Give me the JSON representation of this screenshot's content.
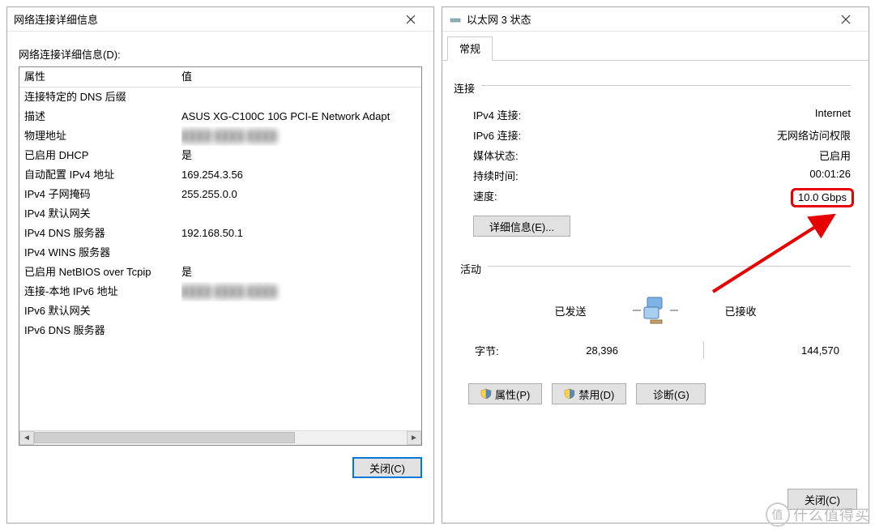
{
  "left": {
    "title": "网络连接详细信息",
    "subtitle": "网络连接详细信息(D):",
    "header_prop": "属性",
    "header_val": "值",
    "rows": [
      {
        "prop": "连接特定的 DNS 后缀",
        "val": ""
      },
      {
        "prop": "描述",
        "val": "ASUS XG-C100C 10G PCI-E Network Adapt"
      },
      {
        "prop": "物理地址",
        "val": "",
        "blurred": true
      },
      {
        "prop": "已启用 DHCP",
        "val": "是"
      },
      {
        "prop": "自动配置 IPv4 地址",
        "val": "169.254.3.56"
      },
      {
        "prop": "IPv4 子网掩码",
        "val": "255.255.0.0"
      },
      {
        "prop": "IPv4 默认网关",
        "val": ""
      },
      {
        "prop": "IPv4 DNS 服务器",
        "val": "192.168.50.1"
      },
      {
        "prop": "IPv4 WINS 服务器",
        "val": ""
      },
      {
        "prop": "已启用 NetBIOS over Tcpip",
        "val": "是"
      },
      {
        "prop": "连接-本地 IPv6 地址",
        "val": "",
        "blurred": true
      },
      {
        "prop": "IPv6 默认网关",
        "val": ""
      },
      {
        "prop": "IPv6 DNS 服务器",
        "val": ""
      }
    ],
    "close_label": "关闭(C)"
  },
  "right": {
    "title": "以太网 3 状态",
    "tab": "常规",
    "section_conn": "连接",
    "rows": [
      {
        "k": "IPv4 连接:",
        "v": "Internet"
      },
      {
        "k": "IPv6 连接:",
        "v": "无网络访问权限"
      },
      {
        "k": "媒体状态:",
        "v": "已启用"
      },
      {
        "k": "持续时间:",
        "v": "00:01:26"
      }
    ],
    "speed_k": "速度:",
    "speed_v": "10.0 Gbps",
    "details_btn": "详细信息(E)...",
    "section_act": "活动",
    "sent_label": "已发送",
    "recv_label": "已接收",
    "bytes_label": "字节:",
    "bytes_sent": "28,396",
    "bytes_recv": "144,570",
    "btn_props": "属性(P)",
    "btn_disable": "禁用(D)",
    "btn_diag": "诊断(G)",
    "close_label": "关闭(C)"
  },
  "watermark": "什么值得买"
}
